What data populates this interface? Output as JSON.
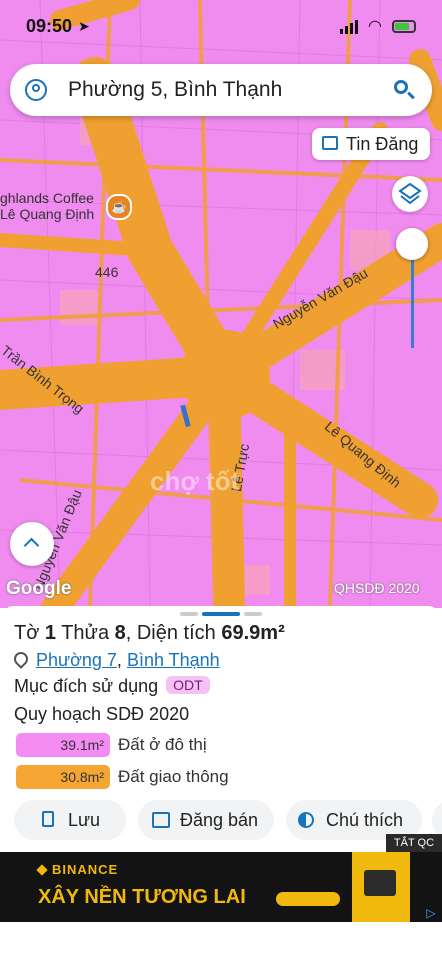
{
  "status_bar": {
    "time": "09:50"
  },
  "search": {
    "query": "Phường 5, Bình Thạnh"
  },
  "map": {
    "listings_button": "Tin Đăng",
    "poi_name_line1": "ghlands Coffee",
    "poi_name_line2": "Lê Quang Định",
    "street_labels": {
      "nguyen_van_dau_east": "Nguyễn Văn Đậu",
      "tran_binh_trong": "Trần Bình Trọng",
      "le_quang_dinh": "Lê Quang Định",
      "le_truc": "Lê Trực",
      "nguyen_van_dau_south": "Nguyễn Văn Đậu",
      "road_number": "446"
    },
    "google_logo": "Google",
    "layer_caption": "QHSDĐ 2020",
    "watermark": "chợ tốt"
  },
  "parcel": {
    "title_prefix": "Tờ ",
    "sheet_no": "1",
    "title_mid": " Thửa ",
    "parcel_no": "8",
    "title_area_label": ", Diện tích ",
    "area": "69.9m²",
    "ward": "Phường 7",
    "comma": ",",
    "district": "Bình Thạnh",
    "purpose_label": "Mục đích sử dụng",
    "purpose_code": "ODT",
    "plan_label": "Quy hoạch SDĐ 2020",
    "legend": [
      {
        "value": "39.1m²",
        "label": "Đất ở đô thị",
        "color": "#f48cf4"
      },
      {
        "value": "30.8m²",
        "label": "Đất giao thông",
        "color": "#f5a534"
      }
    ]
  },
  "actions": {
    "save": "Lưu",
    "post_sale": "Đăng bán",
    "legend": "Chú thích"
  },
  "ad": {
    "close_label": "TẮT QC",
    "brand": "BINANCE",
    "headline": "XÂY NỀN TƯƠNG LAI"
  },
  "colors": {
    "residential": "#f08cf0",
    "road": "#f0a030",
    "link": "#1a73b8"
  }
}
